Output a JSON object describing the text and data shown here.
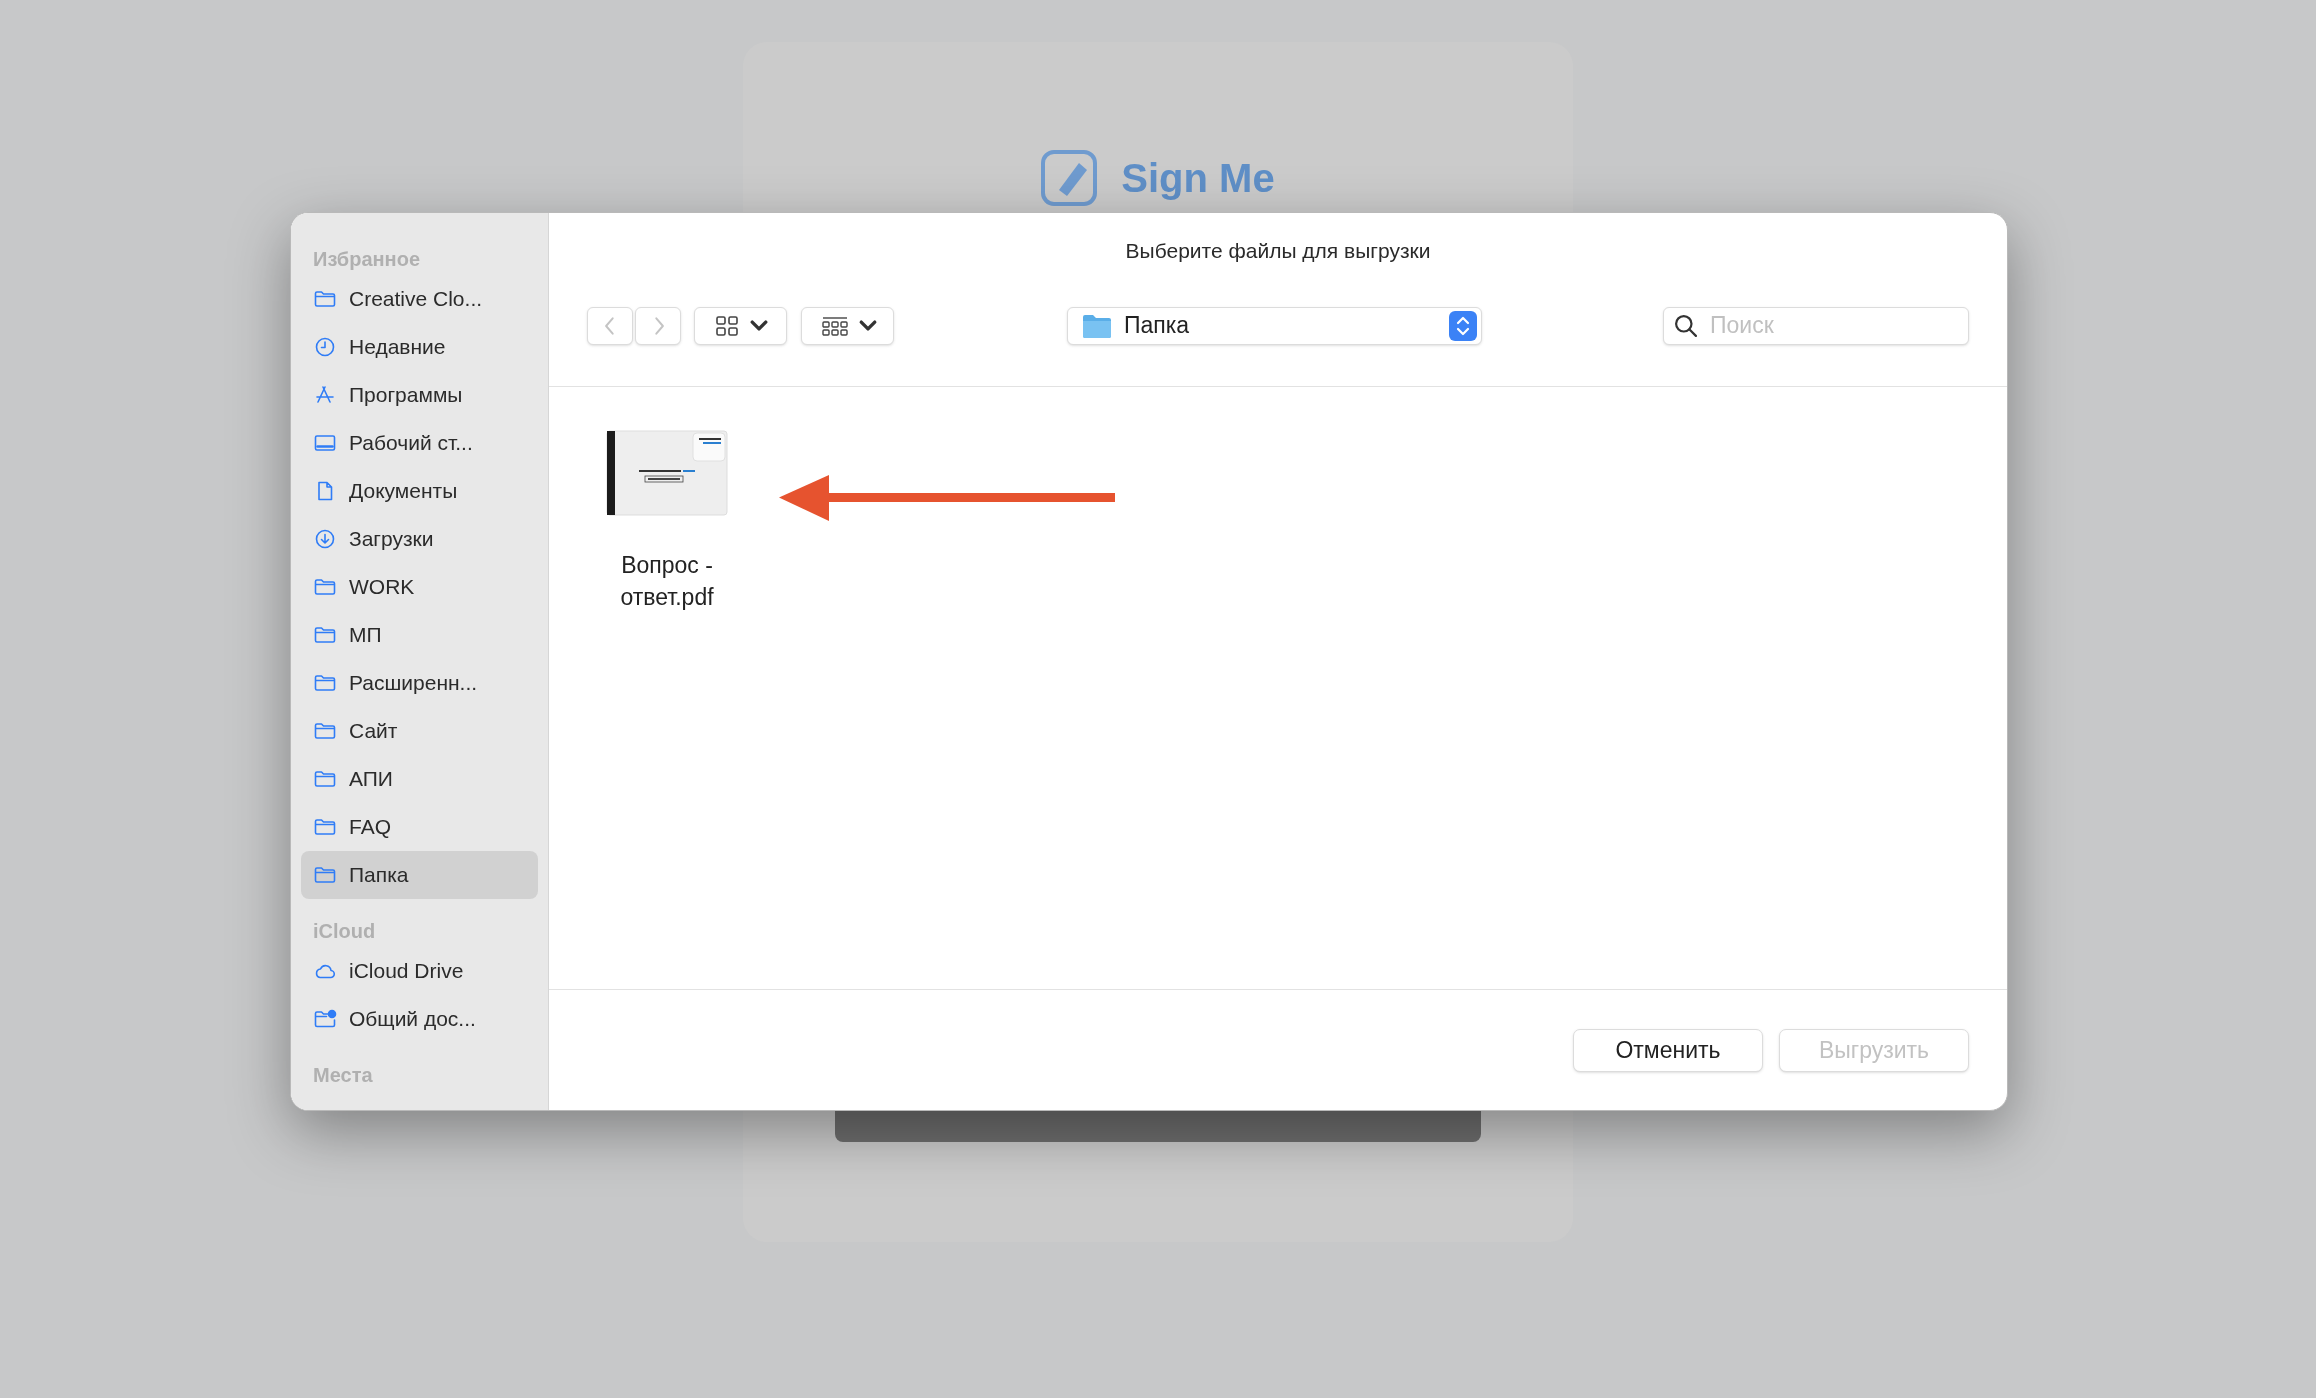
{
  "background_page": {
    "logo_text": "Sign Me"
  },
  "dialog": {
    "title": "Выберите файлы для выгрузки"
  },
  "sidebar": {
    "sections": [
      {
        "heading": "Избранное",
        "items": [
          {
            "label": "Creative Clo...",
            "kind": "folder",
            "selected": false
          },
          {
            "label": "Недавние",
            "kind": "clock",
            "selected": false
          },
          {
            "label": "Программы",
            "kind": "apps",
            "selected": false
          },
          {
            "label": "Рабочий ст...",
            "kind": "desktop",
            "selected": false
          },
          {
            "label": "Документы",
            "kind": "document",
            "selected": false
          },
          {
            "label": "Загрузки",
            "kind": "download",
            "selected": false
          },
          {
            "label": "WORK",
            "kind": "folder",
            "selected": false
          },
          {
            "label": "МП",
            "kind": "folder",
            "selected": false
          },
          {
            "label": "Расширенн...",
            "kind": "folder",
            "selected": false
          },
          {
            "label": "Сайт",
            "kind": "folder",
            "selected": false
          },
          {
            "label": "АПИ",
            "kind": "folder",
            "selected": false
          },
          {
            "label": "FAQ",
            "kind": "folder",
            "selected": false
          },
          {
            "label": "Папка",
            "kind": "folder",
            "selected": true
          }
        ]
      },
      {
        "heading": "iCloud",
        "items": [
          {
            "label": "iCloud Drive",
            "kind": "cloud",
            "selected": false
          },
          {
            "label": "Общий дос...",
            "kind": "shared",
            "selected": false
          }
        ]
      },
      {
        "heading": "Места"
      }
    ]
  },
  "toolbar": {
    "back_disabled": true,
    "forward_disabled": true,
    "location": "Папка",
    "search": {
      "placeholder": "Поиск"
    }
  },
  "files": [
    {
      "name": "Вопрос - ответ.pdf",
      "selected": false
    }
  ],
  "buttons": [
    {
      "label": "Отменить",
      "disabled": false
    },
    {
      "label": "Выгрузить",
      "disabled": true
    }
  ]
}
